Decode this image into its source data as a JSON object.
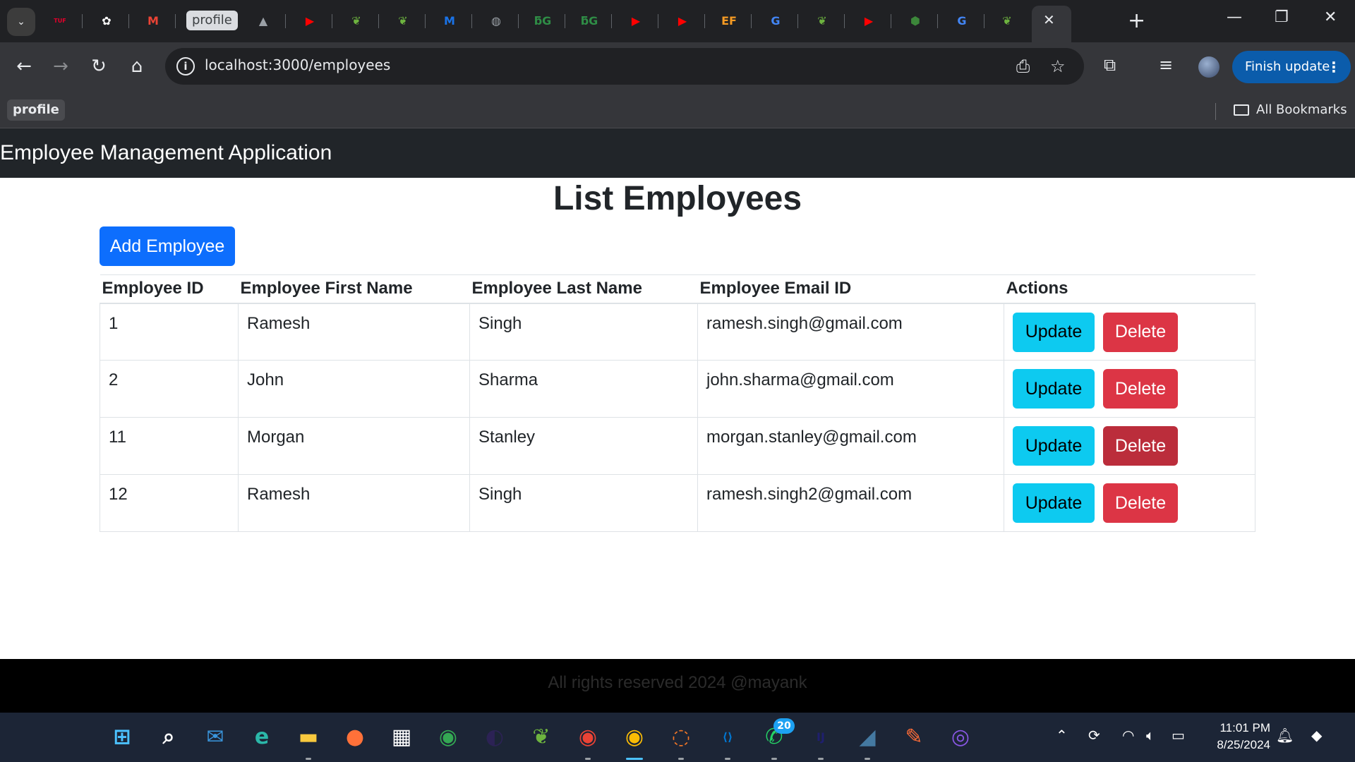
{
  "browser": {
    "tabs": [
      {
        "icon": "tuf-icon",
        "glyph": "TUF",
        "color": "#e4002b"
      },
      {
        "icon": "chatgpt-icon",
        "glyph": "✿",
        "color": "#ffffff"
      },
      {
        "icon": "gmail-icon",
        "glyph": "M",
        "color": "#ea4335"
      },
      {
        "icon": "mountain-icon",
        "glyph": "▲",
        "color": "#9aa0a6"
      },
      {
        "icon": "youtube-icon",
        "glyph": "▶",
        "color": "#ff0000"
      },
      {
        "icon": "spring-icon",
        "glyph": "❦",
        "color": "#6db33f"
      },
      {
        "icon": "spring-icon",
        "glyph": "❦",
        "color": "#6db33f"
      },
      {
        "icon": "mba-icon",
        "glyph": "M",
        "color": "#1a73e8"
      },
      {
        "icon": "globe-icon",
        "glyph": "◍",
        "color": "#9aa0a6"
      },
      {
        "icon": "gfg-icon",
        "glyph": "ƃG",
        "color": "#2f8d46"
      },
      {
        "icon": "gfg-icon",
        "glyph": "ƃG",
        "color": "#2f8d46"
      },
      {
        "icon": "youtube-icon",
        "glyph": "▶",
        "color": "#ff0000"
      },
      {
        "icon": "youtube-icon",
        "glyph": "▶",
        "color": "#ff0000"
      },
      {
        "icon": "ef-icon",
        "glyph": "EF",
        "color": "#f59a23"
      },
      {
        "icon": "google-icon",
        "glyph": "G",
        "color": "#4285f4"
      },
      {
        "icon": "spring-icon",
        "glyph": "❦",
        "color": "#6db33f"
      },
      {
        "icon": "youtube-icon",
        "glyph": "▶",
        "color": "#ff0000"
      },
      {
        "icon": "node-icon",
        "glyph": "⬢",
        "color": "#3c873a"
      },
      {
        "icon": "google-icon",
        "glyph": "G",
        "color": "#4285f4"
      },
      {
        "icon": "spring-icon",
        "glyph": "❦",
        "color": "#6db33f"
      }
    ],
    "profile_tab_label": "profile",
    "url": "localhost:3000/employees",
    "finish_update_label": "Finish update",
    "bookmark_profile": "profile",
    "all_bookmarks": "All Bookmarks"
  },
  "app": {
    "brand": "Employee Management Application",
    "page_title": "List Employees",
    "add_button": "Add Employee",
    "table": {
      "headers": [
        "Employee ID",
        "Employee First Name",
        "Employee Last Name",
        "Employee Email ID",
        "Actions"
      ],
      "rows": [
        {
          "id": "1",
          "first": "Ramesh",
          "last": "Singh",
          "email": "ramesh.singh@gmail.com"
        },
        {
          "id": "2",
          "first": "John",
          "last": "Sharma",
          "email": "john.sharma@gmail.com"
        },
        {
          "id": "11",
          "first": "Morgan",
          "last": "Stanley",
          "email": "morgan.stanley@gmail.com"
        },
        {
          "id": "12",
          "first": "Ramesh",
          "last": "Singh",
          "email": "ramesh.singh2@gmail.com"
        }
      ],
      "update_label": "Update",
      "delete_label": "Delete"
    },
    "footer": "All rights reserved 2024 @mayank"
  },
  "taskbar": {
    "apps": [
      {
        "icon": "windows-start-icon",
        "glyph": "⊞",
        "color": "#4cc2ff"
      },
      {
        "icon": "search-icon",
        "glyph": "⌕",
        "color": "#ffffff"
      },
      {
        "icon": "mail-icon",
        "glyph": "✉",
        "color": "#3a96dd"
      },
      {
        "icon": "edge-icon",
        "glyph": "e",
        "color": "#2bb7a9"
      },
      {
        "icon": "file-explorer-icon",
        "glyph": "▬",
        "color": "#f8c93e"
      },
      {
        "icon": "firefox-icon",
        "glyph": "●",
        "color": "#ff7139"
      },
      {
        "icon": "ms-store-icon",
        "glyph": "▦",
        "color": "#ffffff"
      },
      {
        "icon": "chrome-icon",
        "glyph": "◉",
        "color": "#34a853"
      },
      {
        "icon": "eclipse-icon",
        "glyph": "◐",
        "color": "#2c2255"
      },
      {
        "icon": "spring-tool-icon",
        "glyph": "❦",
        "color": "#6db33f"
      },
      {
        "icon": "chrome-profile-icon",
        "glyph": "◉",
        "color": "#ea4335"
      },
      {
        "icon": "chrome-active-icon",
        "glyph": "◉",
        "color": "#fbbc05"
      },
      {
        "icon": "jupyter-icon",
        "glyph": "◌",
        "color": "#f37626"
      },
      {
        "icon": "vscode-icon",
        "glyph": "⟨⟩",
        "color": "#0078d4"
      },
      {
        "icon": "whatsapp-icon",
        "glyph": "✆",
        "color": "#25d366"
      },
      {
        "icon": "intellij-icon",
        "glyph": "IJ",
        "color": "#1f1f6e"
      },
      {
        "icon": "mysql-dolphin-icon",
        "glyph": "◢",
        "color": "#4479a1"
      },
      {
        "icon": "postman-icon",
        "glyph": "✎",
        "color": "#ff6c37"
      },
      {
        "icon": "github-icon",
        "glyph": "◎",
        "color": "#8957e5"
      }
    ],
    "whatsapp_badge": "20",
    "time": "11:01 PM",
    "date": "8/25/2024"
  }
}
